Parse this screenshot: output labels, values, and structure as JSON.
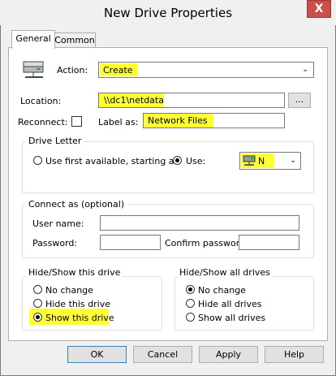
{
  "window": {
    "title": "New Drive Properties",
    "close_glyph": "X"
  },
  "tabs": [
    {
      "label": "General"
    },
    {
      "label": "Common"
    }
  ],
  "action": {
    "label": "Action:",
    "value": "Create"
  },
  "location": {
    "label": "Location:",
    "value": "\\\\dc1\\netdata",
    "browse_label": "..."
  },
  "reconnect": {
    "label": "Reconnect:"
  },
  "label_as": {
    "label": "Label as:",
    "value": "Network Files"
  },
  "drive_letter": {
    "title": "Drive Letter",
    "first_available_label": "Use first available, starting at:",
    "use_label": "Use:",
    "value": "N"
  },
  "connect_as": {
    "title": "Connect as (optional)",
    "user_name_label": "User name:",
    "password_label": "Password:",
    "confirm_password_label": "Confirm password:"
  },
  "hide_show_drive": {
    "title": "Hide/Show this drive",
    "options": [
      "No change",
      "Hide this drive",
      "Show this drive"
    ]
  },
  "hide_show_all": {
    "title": "Hide/Show all drives",
    "options": [
      "No change",
      "Hide all drives",
      "Show all drives"
    ]
  },
  "buttons": {
    "ok": "OK",
    "cancel": "Cancel",
    "apply": "Apply",
    "help": "Help"
  },
  "colors": {
    "highlight": "#ffff33",
    "close_button": "#c7504b"
  }
}
